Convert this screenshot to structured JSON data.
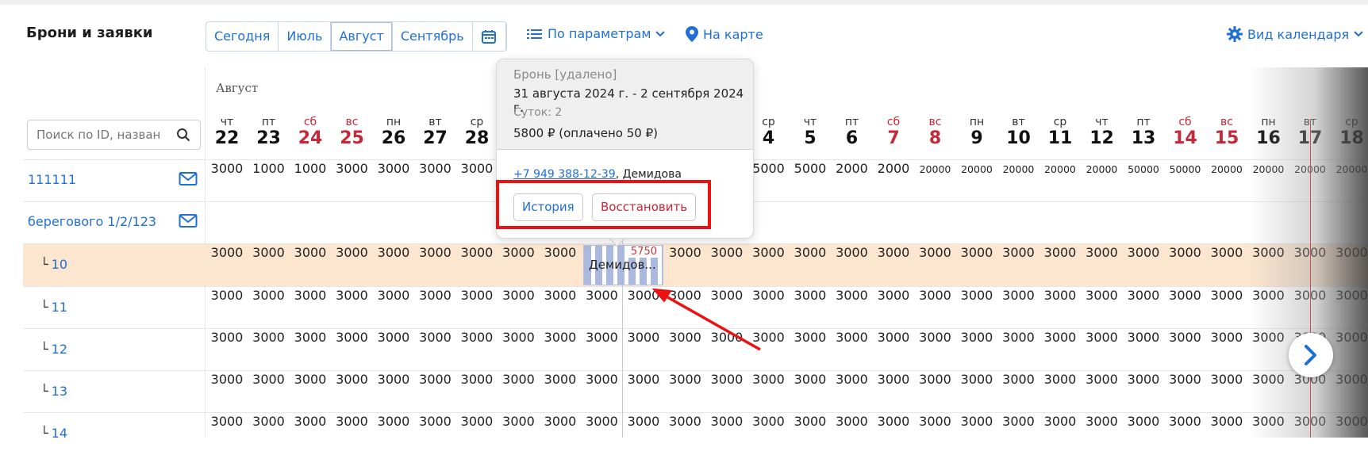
{
  "header": {
    "title": "Брони и заявки",
    "periods": [
      "Сегодня",
      "Июль",
      "Август",
      "Сентябрь"
    ],
    "params_label": "По параметрам",
    "map_label": "На карте",
    "view_label": "Вид календаря"
  },
  "search": {
    "placeholder": "Поиск по ID, назван"
  },
  "calendar": {
    "month": "Август",
    "days": [
      {
        "dow": "чт",
        "num": "22",
        "weekend": false
      },
      {
        "dow": "пт",
        "num": "23",
        "weekend": false
      },
      {
        "dow": "сб",
        "num": "24",
        "weekend": true
      },
      {
        "dow": "вс",
        "num": "25",
        "weekend": true
      },
      {
        "dow": "пн",
        "num": "26",
        "weekend": false
      },
      {
        "dow": "вт",
        "num": "27",
        "weekend": false
      },
      {
        "dow": "ср",
        "num": "28",
        "weekend": false
      },
      {
        "dow": "",
        "num": "",
        "weekend": false
      },
      {
        "dow": "",
        "num": "",
        "weekend": false
      },
      {
        "dow": "",
        "num": "",
        "weekend": false
      },
      {
        "dow": "",
        "num": "",
        "weekend": false
      },
      {
        "dow": "",
        "num": "",
        "weekend": false
      },
      {
        "dow": "",
        "num": "",
        "weekend": false
      },
      {
        "dow": "ср",
        "num": "4",
        "weekend": false
      },
      {
        "dow": "чт",
        "num": "5",
        "weekend": false
      },
      {
        "dow": "пт",
        "num": "6",
        "weekend": false
      },
      {
        "dow": "сб",
        "num": "7",
        "weekend": true
      },
      {
        "dow": "вс",
        "num": "8",
        "weekend": true
      },
      {
        "dow": "пн",
        "num": "9",
        "weekend": false
      },
      {
        "dow": "вт",
        "num": "10",
        "weekend": false
      },
      {
        "dow": "ср",
        "num": "11",
        "weekend": false
      },
      {
        "dow": "чт",
        "num": "12",
        "weekend": false
      },
      {
        "dow": "пт",
        "num": "13",
        "weekend": false
      },
      {
        "dow": "сб",
        "num": "14",
        "weekend": true
      },
      {
        "dow": "вс",
        "num": "15",
        "weekend": true
      },
      {
        "dow": "пн",
        "num": "16",
        "weekend": false
      },
      {
        "dow": "вт",
        "num": "17",
        "weekend": false
      },
      {
        "dow": "ср",
        "num": "18",
        "weekend": false
      }
    ]
  },
  "rows": [
    {
      "label": "111111",
      "type": "object",
      "mail": true,
      "prices": [
        "3000",
        "1000",
        "1000",
        "3000",
        "3000",
        "3000",
        "3000",
        "",
        "",
        "",
        "",
        "",
        "",
        "5000",
        "5000",
        "2000",
        "2000",
        "20000",
        "20000",
        "20000",
        "20000",
        "20000",
        "50000",
        "50000",
        "20000",
        "20000",
        "20000",
        "20000"
      ]
    },
    {
      "label": "берегового 1/2/123",
      "type": "object",
      "mail": true,
      "prices": []
    },
    {
      "label": "10",
      "type": "unit",
      "highlight": true,
      "prices": [
        "3000",
        "3000",
        "3000",
        "3000",
        "3000",
        "3000",
        "3000",
        "3000",
        "3000",
        "",
        "",
        "3000",
        "3000",
        "3000",
        "3000",
        "3000",
        "3000",
        "3000",
        "3000",
        "3000",
        "3000",
        "3000",
        "3000",
        "3000",
        "3000",
        "3000",
        "3000",
        "3000"
      ]
    },
    {
      "label": "11",
      "type": "unit",
      "prices": [
        "3000",
        "3000",
        "3000",
        "3000",
        "3000",
        "3000",
        "3000",
        "3000",
        "3000",
        "3000",
        "3000",
        "3000",
        "3000",
        "3000",
        "3000",
        "3000",
        "3000",
        "3000",
        "3000",
        "3000",
        "3000",
        "3000",
        "3000",
        "3000",
        "3000",
        "3000",
        "3000",
        "3000"
      ]
    },
    {
      "label": "12",
      "type": "unit",
      "prices": [
        "3000",
        "3000",
        "3000",
        "3000",
        "3000",
        "3000",
        "3000",
        "3000",
        "3000",
        "3000",
        "3000",
        "3000",
        "3000",
        "3000",
        "3000",
        "3000",
        "3000",
        "3000",
        "3000",
        "3000",
        "3000",
        "3000",
        "3000",
        "3000",
        "3000",
        "3000",
        "3000",
        "3000"
      ]
    },
    {
      "label": "13",
      "type": "unit",
      "prices": [
        "3000",
        "3000",
        "3000",
        "3000",
        "3000",
        "3000",
        "3000",
        "3000",
        "3000",
        "3000",
        "3000",
        "3000",
        "3000",
        "3000",
        "3000",
        "3000",
        "3000",
        "3000",
        "3000",
        "3000",
        "3000",
        "3000",
        "3000",
        "3000",
        "3000",
        "3000",
        "3000",
        "3000"
      ]
    },
    {
      "label": "14",
      "type": "unit",
      "prices": [
        "3000",
        "3000",
        "3000",
        "3000",
        "3000",
        "3000",
        "3000",
        "3000",
        "3000",
        "3000",
        "3000",
        "3000",
        "3000",
        "3000",
        "3000",
        "3000",
        "3000",
        "3000",
        "3000",
        "3000",
        "3000",
        "3000",
        "3000",
        "3000",
        "3000",
        "3000",
        "3000",
        "3000"
      ]
    }
  ],
  "booking": {
    "price": "5750",
    "name": "Демидов..."
  },
  "popup": {
    "status": "Бронь [удалено]",
    "dates": "31 августа 2024 г. - 2 сентября 2024 г.",
    "nights": "Суток: 2",
    "sum": "5800 ₽ (оплачено 50 ₽)",
    "phone": "+7 949 388-12-39",
    "guest": ", Демидова",
    "history_label": "История",
    "restore_label": "Восстановить"
  },
  "colors": {
    "accent": "#1f6fd6",
    "weekend": "#c6283a",
    "highlight_row": "#fde6cf",
    "annotation": "#ee1111"
  }
}
